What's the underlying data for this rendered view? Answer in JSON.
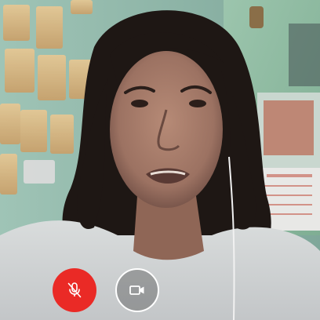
{
  "call": {
    "view": "self-video-preview",
    "microphone": {
      "state": "muted",
      "icon": "mic-off-icon",
      "color": "#ea2a26"
    },
    "camera": {
      "state": "on",
      "icon": "video-camera-icon",
      "border_color": "#ffffff"
    }
  }
}
